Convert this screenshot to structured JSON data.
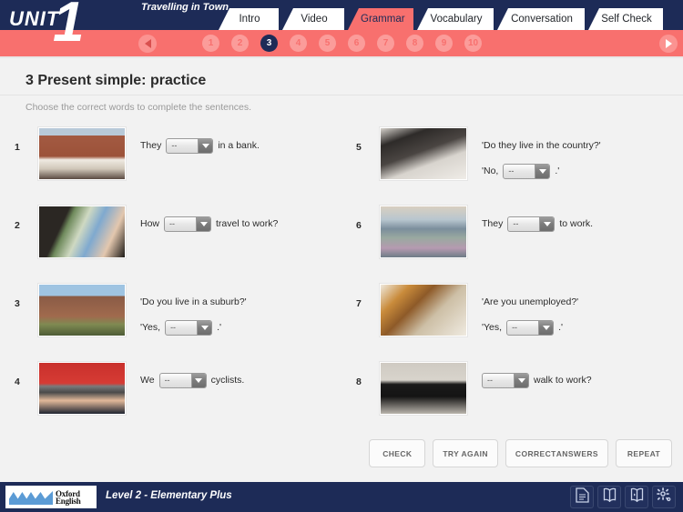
{
  "header": {
    "unit_word": "UNIT",
    "unit_number": "1",
    "lesson_title": "Travelling in Town",
    "tabs": [
      {
        "label": "Intro",
        "active": false
      },
      {
        "label": "Video",
        "active": false
      },
      {
        "label": "Grammar",
        "active": true
      },
      {
        "label": "Vocabulary",
        "active": false
      },
      {
        "label": "Conversation",
        "active": false
      },
      {
        "label": "Self Check",
        "active": false
      }
    ],
    "pages": [
      "1",
      "2",
      "3",
      "4",
      "5",
      "6",
      "7",
      "8",
      "9",
      "10"
    ],
    "active_page": "3",
    "prev_arrow_icon": "triangle-left-icon",
    "next_arrow_icon": "triangle-right-icon",
    "colors": {
      "navy": "#1d2b57",
      "coral": "#f8706e",
      "dot": "#fb9c9a"
    }
  },
  "content": {
    "page_title": "3 Present simple: practice",
    "instruction": "Choose the correct words to complete the sentences.",
    "dropdown_placeholder": "--",
    "items": [
      {
        "num": "1",
        "image": "shopfront-photo",
        "lines": [
          {
            "pre": "They",
            "dropdown": true,
            "post": "in a bank."
          }
        ]
      },
      {
        "num": "2",
        "image": "woman-driving-car-photo",
        "lines": [
          {
            "pre": "How",
            "dropdown": true,
            "post": "travel to work?"
          }
        ]
      },
      {
        "num": "3",
        "image": "suburban-houses-photo",
        "lines": [
          {
            "pre": "'Do you live in a suburb?'",
            "dropdown": false,
            "post": ""
          },
          {
            "pre": "'Yes,",
            "dropdown": true,
            "post": ".'"
          }
        ]
      },
      {
        "num": "4",
        "image": "couple-by-red-bus-photo",
        "lines": [
          {
            "pre": "We",
            "dropdown": true,
            "post": "cyclists."
          }
        ]
      },
      {
        "num": "5",
        "image": "commuters-walking-photo",
        "lines": [
          {
            "pre": "'Do they live in the country?'",
            "dropdown": false,
            "post": ""
          },
          {
            "pre": "'No,",
            "dropdown": true,
            "post": ".'"
          }
        ]
      },
      {
        "num": "6",
        "image": "bus-interior-photo",
        "lines": [
          {
            "pre": "They",
            "dropdown": true,
            "post": "to work."
          }
        ]
      },
      {
        "num": "7",
        "image": "woman-with-bag-photo",
        "lines": [
          {
            "pre": "'Are you unemployed?'",
            "dropdown": false,
            "post": ""
          },
          {
            "pre": "'Yes,",
            "dropdown": true,
            "post": ".'"
          }
        ]
      },
      {
        "num": "8",
        "image": "walking-shadow-photo",
        "lines": [
          {
            "pre": "",
            "dropdown": true,
            "post": "walk to work?"
          }
        ]
      }
    ]
  },
  "actions": [
    {
      "label": "CHECK",
      "label2": ""
    },
    {
      "label": "TRY AGAIN",
      "label2": ""
    },
    {
      "label": "CORRECT",
      "label2": "ANSWERS"
    },
    {
      "label": "REPEAT",
      "label2": ""
    }
  ],
  "footer": {
    "logo_brand": "Oxford",
    "logo_brand2": "English",
    "level": "Level 2 - Elementary Plus",
    "icons": [
      "document-icon",
      "book-icon",
      "book-audio-icon",
      "gear-icon"
    ]
  }
}
